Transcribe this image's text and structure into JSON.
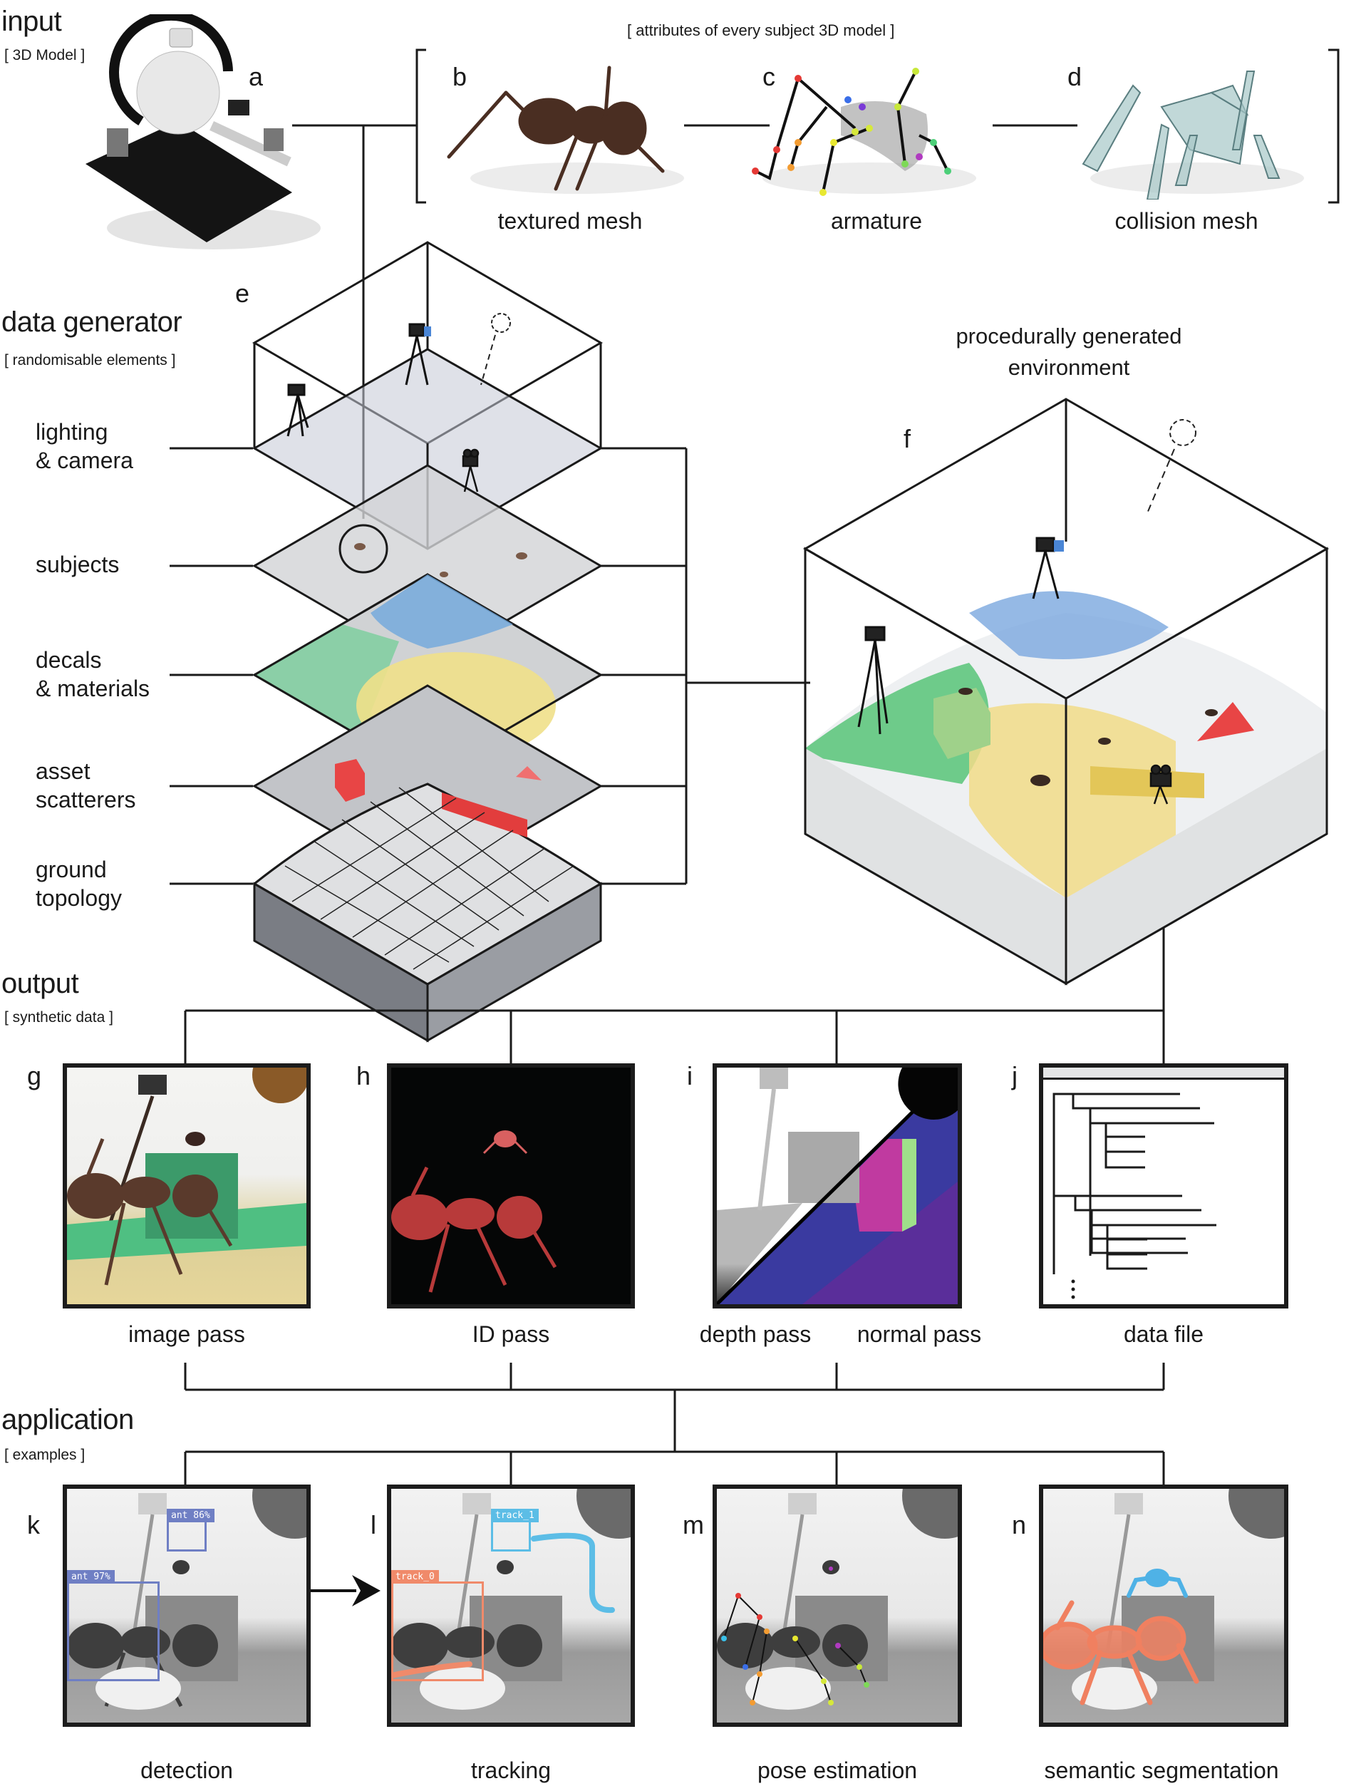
{
  "sections": {
    "input": {
      "title": "input",
      "subtitle": "[ 3D Model ]"
    },
    "data_generator": {
      "title": "data generator",
      "subtitle": "[ randomisable elements ]"
    },
    "output": {
      "title": "output",
      "subtitle": "[ synthetic data ]"
    },
    "application": {
      "title": "application",
      "subtitle": "[ examples ]"
    }
  },
  "attributes_header": "[ attributes of every subject 3D model ]",
  "panels": {
    "a": {
      "letter": "a",
      "caption": ""
    },
    "b": {
      "letter": "b",
      "caption": "textured mesh"
    },
    "c": {
      "letter": "c",
      "caption": "armature"
    },
    "d": {
      "letter": "d",
      "caption": "collision mesh"
    },
    "e": {
      "letter": "e"
    },
    "f": {
      "letter": "f",
      "caption_line1": "procedurally generated",
      "caption_line2": "environment"
    },
    "g": {
      "letter": "g",
      "caption": "image pass"
    },
    "h": {
      "letter": "h",
      "caption": "ID pass"
    },
    "i": {
      "letter": "i",
      "caption_left": "depth pass",
      "caption_right": "normal pass"
    },
    "j": {
      "letter": "j",
      "caption": "data file"
    },
    "k": {
      "letter": "k",
      "caption": "detection"
    },
    "l": {
      "letter": "l",
      "caption": "tracking"
    },
    "m": {
      "letter": "m",
      "caption": "pose estimation"
    },
    "n": {
      "letter": "n",
      "caption": "semantic segmentation"
    }
  },
  "layers": [
    {
      "line1": "lighting",
      "line2": "& camera"
    },
    {
      "line1": "subjects",
      "line2": ""
    },
    {
      "line1": "decals",
      "line2": "& materials"
    },
    {
      "line1": "asset",
      "line2": "scatterers"
    },
    {
      "line1": "ground",
      "line2": "topology"
    }
  ],
  "detection": {
    "boxes": [
      {
        "label": "ant 86%",
        "color": "#6f7fc4"
      },
      {
        "label": "ant 97%",
        "color": "#6f7fc4"
      }
    ]
  },
  "tracking": {
    "boxes": [
      {
        "label": "track_1",
        "color": "#5cbde6"
      },
      {
        "label": "track_0",
        "color": "#f08a6a"
      }
    ]
  },
  "colors": {
    "line": "#1a1a1a",
    "ant_brown": "#5a3a2c",
    "id_red": "#b83a3a",
    "decal_green": "#6fcf97",
    "decal_yellow": "#efe08a",
    "decal_blue": "#6fa8dc",
    "asset_red": "#e84545",
    "seg_orange": "#f08060",
    "seg_blue": "#4fb2e6",
    "normal_purple": "#5a2e9a"
  }
}
